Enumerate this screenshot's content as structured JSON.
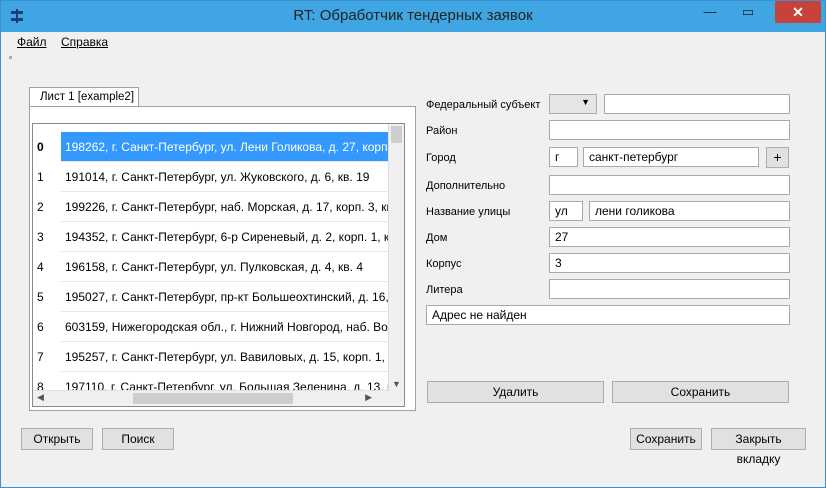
{
  "window": {
    "title": "RT: Обработчик тендерных заявок",
    "minimize_icon": "minimize-icon",
    "maximize_icon": "maximize-icon",
    "close_icon": "close-icon",
    "close_glyph": "✕",
    "min_glyph": "—",
    "max_glyph": "▭"
  },
  "menu": {
    "file": "Файл",
    "help": "Справка"
  },
  "tab": {
    "label": "Лист 1 [example2]"
  },
  "table": {
    "rows": [
      {
        "index": "0",
        "address": "198262, г. Санкт-Петербург, ул. Лени Голикова, д. 27, корп."
      },
      {
        "index": "1",
        "address": "191014, г. Санкт-Петербург, ул. Жуковского, д. 6, кв. 19"
      },
      {
        "index": "2",
        "address": "199226, г. Санкт-Петербург, наб. Морская, д. 17, корп. 3, кв."
      },
      {
        "index": "3",
        "address": "194352, г. Санкт-Петербург, 6-р Сиреневый, д. 2, корп. 1, кв"
      },
      {
        "index": "4",
        "address": "196158, г. Санкт-Петербург, ул. Пулковская, д. 4, кв. 4"
      },
      {
        "index": "5",
        "address": "195027, г. Санкт-Петербург, пр-кт Большеохтинский, д. 16,"
      },
      {
        "index": "6",
        "address": "603159, Нижегородская обл., г. Нижний Новгород, наб. Вол"
      },
      {
        "index": "7",
        "address": "195257, г. Санкт-Петербург, ул. Вавиловых, д. 15, корп. 1, кв"
      },
      {
        "index": "8",
        "address": "197110, г. Санкт-Петербург, ул. Большая Зеленина, д. 13, кв."
      }
    ]
  },
  "form": {
    "federal_subject_label": "Федеральный субъект",
    "federal_subject_value": "",
    "district_label": "Район",
    "district_value": "",
    "city_label": "Город",
    "city_type": "г",
    "city_value": "санкт-петербург",
    "plus": "+",
    "additional_label": "Дополнительно",
    "additional_value": "",
    "street_label": "Название улицы",
    "street_type": "ул",
    "street_value": "лени голикова",
    "house_label": "Дом",
    "house_value": "27",
    "building_label": "Корпус",
    "building_value": "3",
    "letter_label": "Литера",
    "letter_value": "",
    "status": "Адрес не найден",
    "delete_button": "Удалить",
    "save_button": "Сохранить"
  },
  "bottom": {
    "open": "Открыть",
    "search": "Поиск",
    "save": "Сохранить",
    "close_tab": "Закрыть вкладку"
  }
}
